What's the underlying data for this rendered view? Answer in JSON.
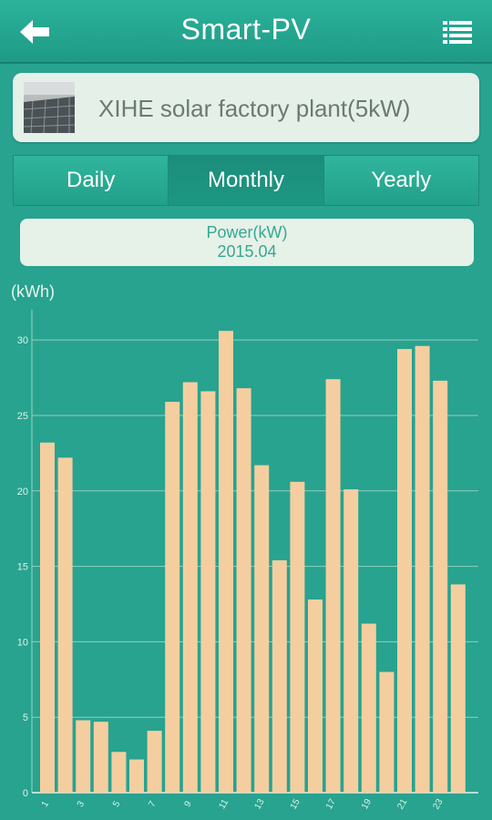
{
  "header": {
    "title": "Smart-PV",
    "back_icon": "back-arrow-icon",
    "menu_icon": "list-menu-icon"
  },
  "plant": {
    "name": "XIHE solar factory plant(5kW)",
    "thumbnail": "solar-panel-thumbnail"
  },
  "tabs": [
    {
      "label": "Daily",
      "active": false
    },
    {
      "label": "Monthly",
      "active": true
    },
    {
      "label": "Yearly",
      "active": false
    }
  ],
  "power_box": {
    "label": "Power(kW)",
    "date": "2015.04"
  },
  "colors": {
    "background": "#27a38f",
    "bar": "#f5ceа0",
    "card": "#e5f1e8",
    "accent": "#35a892"
  },
  "chart_data": {
    "type": "bar",
    "unit_label": "(kWh)",
    "categories": [
      "1",
      "2",
      "3",
      "4",
      "5",
      "6",
      "7",
      "8",
      "9",
      "10",
      "11",
      "12",
      "13",
      "14",
      "15",
      "16",
      "17",
      "18",
      "19",
      "20",
      "21",
      "22",
      "23",
      "24"
    ],
    "x_tick_labels": [
      "1",
      "3",
      "5",
      "7",
      "9",
      "11",
      "13",
      "15",
      "17",
      "19",
      "21",
      "23"
    ],
    "values": [
      23.2,
      22.2,
      4.8,
      4.7,
      2.7,
      2.2,
      4.1,
      25.9,
      27.2,
      26.6,
      30.6,
      26.8,
      21.7,
      15.4,
      20.6,
      12.8,
      27.4,
      20.1,
      11.2,
      8.0,
      29.4,
      29.6,
      27.3,
      13.8
    ],
    "ylim": [
      0,
      32
    ],
    "y_ticks": [
      0,
      5,
      10,
      15,
      20,
      25,
      30
    ],
    "grid": true,
    "xlabel": "",
    "ylabel": ""
  }
}
